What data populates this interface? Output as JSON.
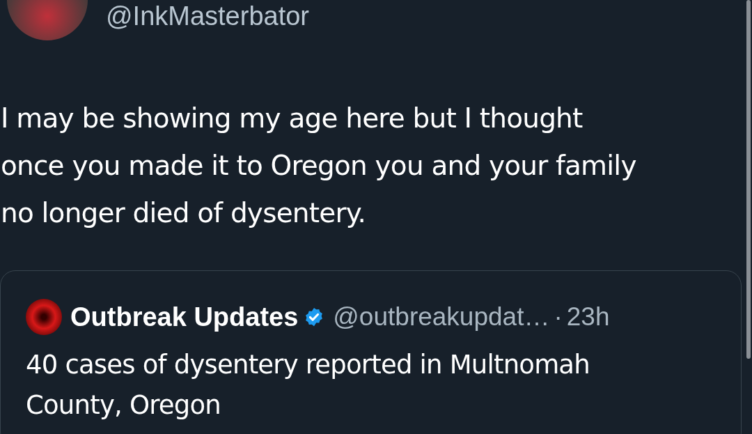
{
  "author": {
    "handle": "@InkMasterbator"
  },
  "tweet": {
    "text": "I may be showing my age here but I thought\nonce you made it to Oregon you and your family\nno longer died of dysentery."
  },
  "quoted_tweet": {
    "name": "Outbreak Updates",
    "verified": true,
    "handle": "@outbreakupdat…",
    "separator": "·",
    "time": "23h",
    "text": "40 cases of dysentery reported in Multnomah\nCounty, Oregon"
  }
}
